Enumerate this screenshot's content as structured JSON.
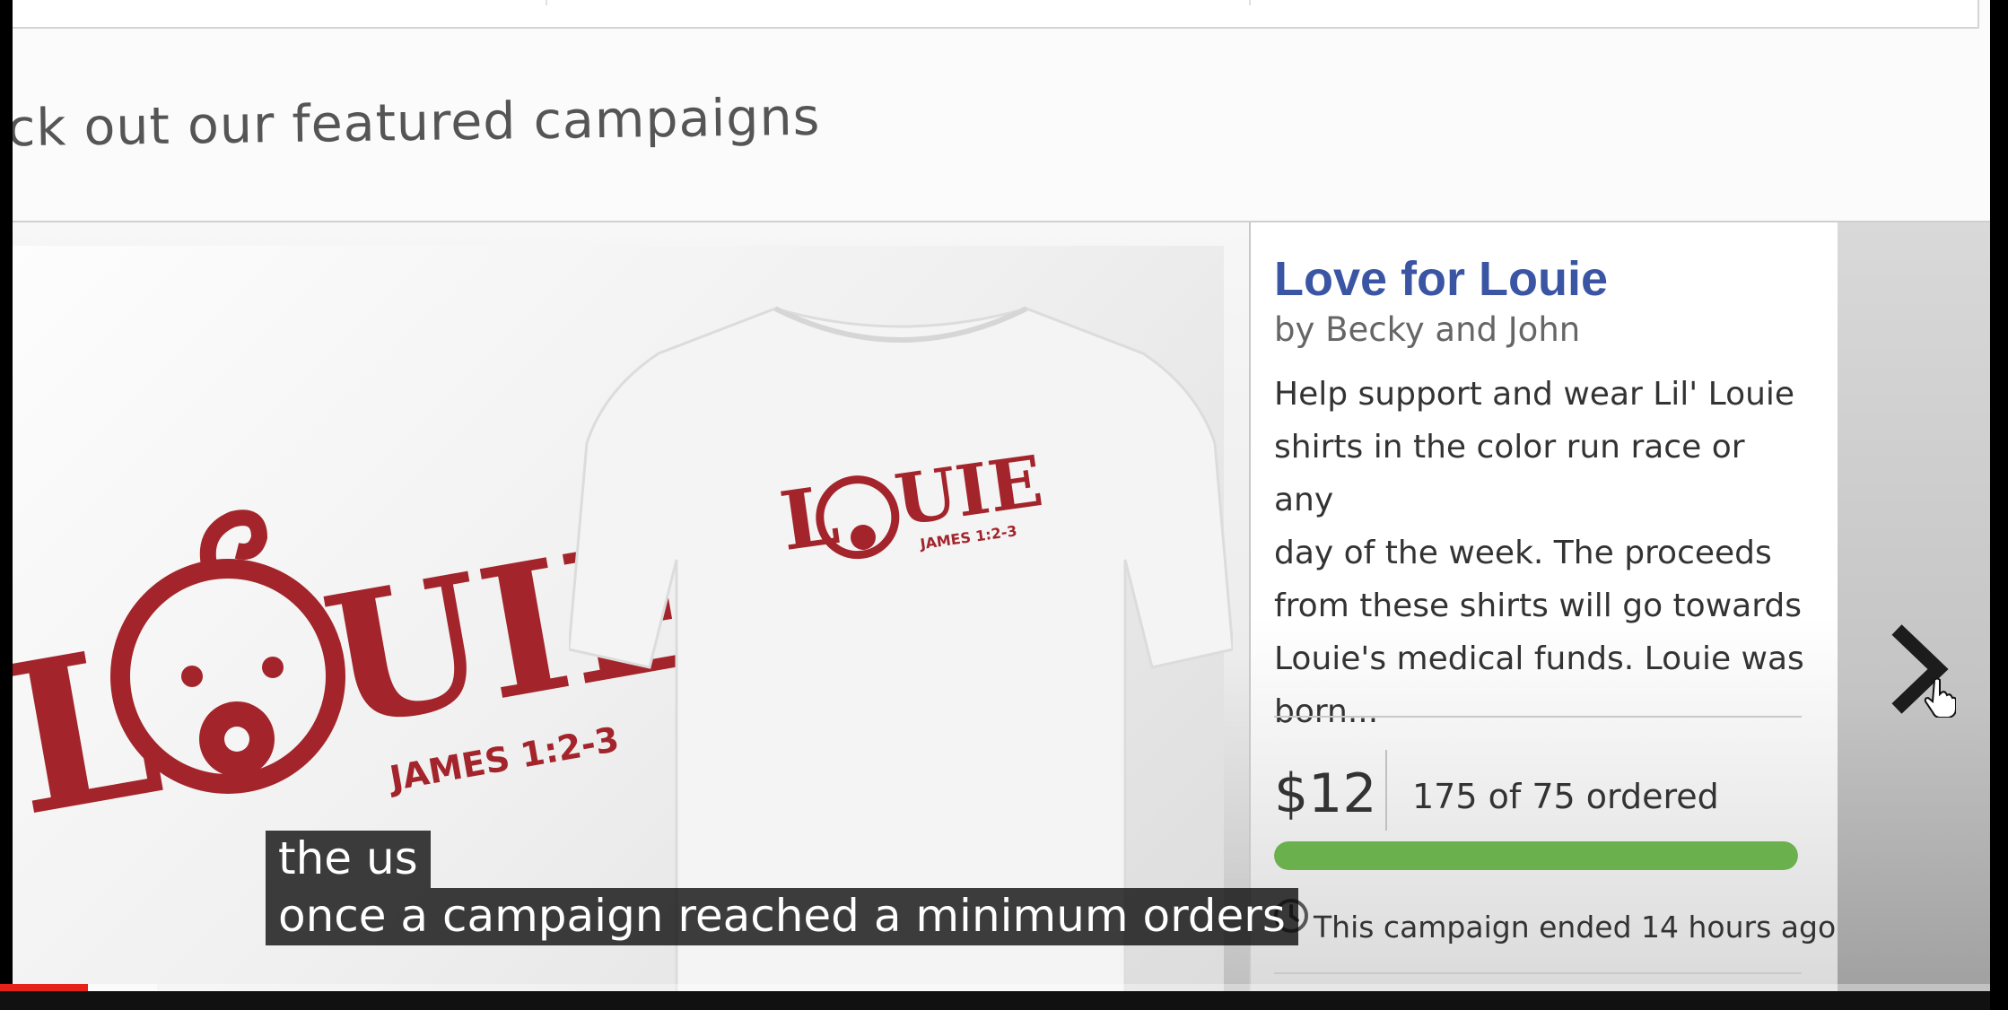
{
  "section": {
    "heading": "ck out our featured campaigns"
  },
  "campaign": {
    "title": "Love for Louie",
    "byline": "by Becky and John",
    "description_lines": [
      "Help support and wear Lil' Louie",
      "shirts in the color run race or any",
      "day of the week. The proceeds",
      "from these shirts will go towards",
      "Louie's medical funds. Louie was",
      "born..."
    ],
    "price": "$12",
    "ordered_text": "175 of 75 ordered",
    "progress_fraction": 1.0,
    "ended_text": "This campaign ended 14 hours ago",
    "logo_word": "LOUIE",
    "logo_verse": "JAMES 1:2-3"
  },
  "colors": {
    "title_blue": "#3a55a3",
    "progress_green": "#6ab04c",
    "logo_red": "#a3252b",
    "video_red": "#e62117"
  },
  "icons": {
    "next": "chevron-right-icon",
    "clock": "clock-icon",
    "cursor": "hand-pointer-icon"
  },
  "subtitles": {
    "line1": "the us",
    "line2": "once a campaign reached a minimum orders"
  },
  "video": {
    "played_fraction": 0.044,
    "buffered_fraction": 0.078
  }
}
